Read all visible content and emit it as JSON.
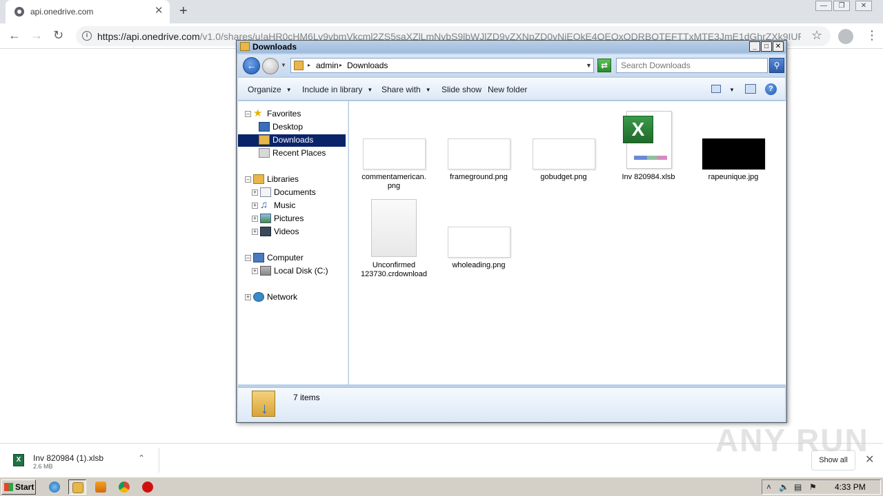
{
  "browser": {
    "tab_title": "api.onedrive.com",
    "url_host": "https://api.onedrive.com",
    "url_path": "/v1.0/shares/u!aHR0cHM6Ly9vbmVkcml2ZS5saXZlLmNvbS9lbWJlZD9yZXNpZD0yNjEOkE4QEQxODRBQTEFTTxMTE3JmE1dGhrZXk9IUFK...",
    "new_tab_glyph": "+",
    "close_glyph": "✕"
  },
  "explorer": {
    "title": "Downloads",
    "breadcrumb": [
      "admin",
      "Downloads"
    ],
    "search_placeholder": "Search Downloads",
    "commands": {
      "organize": "Organize",
      "include_in_library": "Include in library",
      "share_with": "Share with",
      "slide_show": "Slide show",
      "new_folder": "New folder"
    },
    "nav": {
      "favorites": "Favorites",
      "desktop": "Desktop",
      "downloads": "Downloads",
      "recent_places": "Recent Places",
      "libraries": "Libraries",
      "documents": "Documents",
      "music": "Music",
      "pictures": "Pictures",
      "videos": "Videos",
      "computer": "Computer",
      "local_disk": "Local Disk (C:)",
      "network": "Network"
    },
    "files": [
      {
        "name": "commentamerican.png",
        "line1": "commentamerican.",
        "line2": "png"
      },
      {
        "name": "frameground.png"
      },
      {
        "name": "gobudget.png"
      },
      {
        "name": "Inv 820984.xlsb"
      },
      {
        "name": "rapeunique.jpg"
      },
      {
        "name": "Unconfirmed 123730.crdownload",
        "line1": "Unconfirmed",
        "line2": "123730.crdownload"
      },
      {
        "name": "wholeading.png"
      }
    ],
    "status": "7 items"
  },
  "download_shelf": {
    "file_name": "Inv 820984 (1).xlsb",
    "file_size": "2.6 MB",
    "show_all": "Show all"
  },
  "watermark": "ANY RUN",
  "taskbar": {
    "start": "Start",
    "clock": "4:33 PM"
  }
}
